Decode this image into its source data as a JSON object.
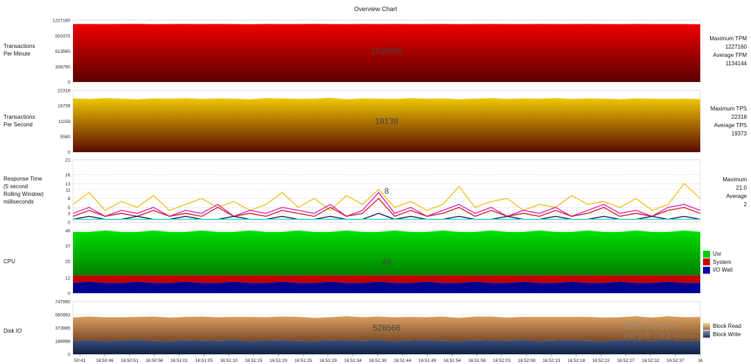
{
  "title": "Overview Chart",
  "panels": {
    "tpm": {
      "label_lines": [
        "Transactions",
        "Per Minute"
      ],
      "stats_lines": [
        "Maximum TPM",
        "1227160",
        "Average TPM",
        "1134144"
      ],
      "current_value": "1144896"
    },
    "tps": {
      "label_lines": [
        "Transactions",
        "Per Second"
      ],
      "stats_lines": [
        "Maximum TPS",
        "22318",
        "Average TPS",
        "19373"
      ],
      "current_value": "19139"
    },
    "response": {
      "label_lines": [
        "Response Time",
        "(5 second",
        "Rolling Window)",
        "milliseconds"
      ],
      "stats_lines": [
        "Maximum",
        "21.0",
        "Average",
        "2"
      ],
      "current_value": "8"
    },
    "cpu": {
      "label_lines": [
        "CPU"
      ],
      "current_value": "48",
      "legend": [
        {
          "label": "Usr",
          "color": "#00cc00"
        },
        {
          "label": "System",
          "color": "#cc0000"
        },
        {
          "label": "I/O Wait",
          "color": "#0000aa"
        }
      ]
    },
    "disk": {
      "label_lines": [
        "Disk IO"
      ],
      "current_value": "528566",
      "legend": [
        {
          "label": "Block Read",
          "color": "#d9b27a"
        },
        {
          "label": "Block Write",
          "color": "#4a6a9a"
        }
      ]
    }
  },
  "watermark": {
    "line1": "激活 Windows",
    "line2": "转到\"设置\"以激活 Windows。"
  },
  "chart_data": [
    {
      "type": "area",
      "ylabel": "Transactions Per Minute",
      "ylim": [
        0,
        1227160
      ],
      "yticks": [
        "0",
        "306790",
        "613580",
        "920370",
        "1227160"
      ],
      "series": [
        {
          "name": "TPM",
          "values": [
            1150000,
            1152000,
            1149000,
            1151000,
            1153000,
            1148000,
            1150000,
            1152000,
            1149000,
            1151000,
            1150000,
            1147000,
            1152000,
            1150000,
            1149000,
            1153000,
            1150000,
            1148000,
            1151000,
            1150000,
            1152000,
            1149000,
            1150000,
            1151000,
            1148000,
            1150000,
            1152000,
            1149000,
            1150000,
            1151000,
            1150000,
            1149000,
            1152000,
            1150000,
            1148000,
            1151000,
            1150000,
            1149000,
            1150000,
            1144896
          ]
        }
      ]
    },
    {
      "type": "area",
      "ylabel": "Transactions Per Second",
      "ylim": [
        0,
        22318
      ],
      "yticks": [
        "0",
        "5580",
        "11159",
        "16739",
        "22318"
      ],
      "series": [
        {
          "name": "TPS",
          "values": [
            19400,
            19200,
            19500,
            19300,
            19100,
            19400,
            19300,
            19500,
            19200,
            19400,
            19300,
            19100,
            19500,
            19400,
            19200,
            19300,
            19600,
            19100,
            19400,
            19300,
            19200,
            19500,
            19300,
            19400,
            19100,
            19300,
            19500,
            19200,
            19400,
            19300,
            19500,
            19200,
            19400,
            19300,
            19100,
            19400,
            19300,
            19200,
            19300,
            19139
          ]
        }
      ]
    },
    {
      "type": "line",
      "ylabel": "Response Time (5 second Rolling Window) milliseconds",
      "ylim": [
        0,
        21
      ],
      "yticks": [
        "0",
        "3",
        "5",
        "8",
        "11",
        "13",
        "16",
        "21"
      ],
      "series": [
        {
          "color": "#f0c020",
          "values": [
            6,
            10,
            4,
            7,
            5,
            9,
            4,
            6,
            8,
            5,
            7,
            4,
            6,
            10,
            5,
            8,
            4,
            9,
            6,
            11,
            5,
            7,
            4,
            6,
            12,
            5,
            7,
            8,
            4,
            6,
            5,
            9,
            6,
            7,
            5,
            8,
            4,
            6,
            13,
            8
          ]
        },
        {
          "color": "#e020c0",
          "values": [
            3,
            5,
            2,
            4,
            3,
            5,
            2,
            4,
            3,
            6,
            2,
            4,
            3,
            5,
            4,
            3,
            6,
            2,
            4,
            10,
            3,
            5,
            2,
            4,
            6,
            3,
            5,
            2,
            4,
            3,
            5,
            2,
            4,
            6,
            3,
            4,
            2,
            5,
            6,
            4
          ]
        },
        {
          "color": "#cc2020",
          "values": [
            2,
            4,
            2,
            3,
            2,
            4,
            2,
            3,
            2,
            5,
            2,
            3,
            2,
            4,
            3,
            2,
            5,
            2,
            3,
            8,
            2,
            4,
            2,
            3,
            5,
            2,
            4,
            2,
            3,
            2,
            4,
            2,
            3,
            5,
            2,
            3,
            2,
            4,
            5,
            3
          ]
        },
        {
          "color": "#101060",
          "values": [
            1,
            2,
            1,
            1,
            2,
            1,
            1,
            2,
            1,
            1,
            2,
            1,
            1,
            2,
            1,
            1,
            2,
            1,
            1,
            3,
            1,
            2,
            1,
            1,
            2,
            1,
            1,
            2,
            1,
            1,
            2,
            1,
            1,
            2,
            1,
            1,
            2,
            1,
            2,
            1
          ]
        },
        {
          "color": "#20d8c0",
          "values": [
            1,
            1,
            1,
            1,
            1,
            1,
            1,
            1,
            1,
            1,
            1,
            1,
            1,
            1,
            1,
            1,
            1,
            1,
            1,
            1,
            1,
            1,
            1,
            1,
            1,
            1,
            1,
            1,
            1,
            1,
            1,
            1,
            1,
            1,
            1,
            1,
            1,
            1,
            1,
            1
          ]
        }
      ]
    },
    {
      "type": "area",
      "ylabel": "CPU",
      "ylim": [
        0,
        49
      ],
      "yticks": [
        "0",
        "12",
        "25",
        "37",
        "49"
      ],
      "series": [
        {
          "name": "I/O Wait",
          "values": [
            8,
            9,
            8,
            8,
            9,
            8,
            8,
            9,
            8,
            8,
            9,
            8,
            8,
            9,
            8,
            8,
            9,
            8,
            8,
            9,
            8,
            8,
            9,
            8,
            8,
            9,
            8,
            8,
            9,
            8,
            8,
            9,
            8,
            8,
            9,
            8,
            8,
            9,
            8,
            8
          ]
        },
        {
          "name": "System",
          "values": [
            6,
            5,
            6,
            6,
            5,
            6,
            6,
            5,
            6,
            6,
            5,
            6,
            6,
            5,
            6,
            6,
            5,
            6,
            6,
            5,
            6,
            6,
            5,
            6,
            6,
            5,
            6,
            6,
            5,
            6,
            6,
            5,
            6,
            6,
            5,
            6,
            6,
            5,
            6,
            6
          ]
        },
        {
          "name": "Usr",
          "values": [
            34,
            34,
            35,
            34,
            34,
            35,
            34,
            34,
            35,
            34,
            34,
            35,
            34,
            34,
            35,
            34,
            34,
            35,
            34,
            34,
            35,
            34,
            34,
            35,
            34,
            34,
            35,
            34,
            34,
            35,
            34,
            34,
            35,
            34,
            34,
            35,
            34,
            34,
            35,
            34
          ]
        }
      ]
    },
    {
      "type": "area",
      "ylabel": "Disk IO",
      "ylim": [
        0,
        747990
      ],
      "yticks": [
        "0",
        "186998",
        "373995",
        "560993",
        "747990"
      ],
      "series": [
        {
          "name": "Block Write",
          "values": [
            190000,
            200000,
            185000,
            195000,
            205000,
            190000,
            185000,
            200000,
            195000,
            190000,
            205000,
            185000,
            195000,
            200000,
            190000,
            185000,
            200000,
            195000,
            190000,
            205000,
            185000,
            195000,
            200000,
            190000,
            185000,
            200000,
            195000,
            190000,
            205000,
            185000,
            195000,
            200000,
            190000,
            185000,
            200000,
            195000,
            190000,
            205000,
            185000,
            195000
          ]
        },
        {
          "name": "Block Read",
          "values": [
            330000,
            335000,
            340000,
            330000,
            325000,
            345000,
            335000,
            330000,
            340000,
            335000,
            325000,
            345000,
            330000,
            335000,
            340000,
            330000,
            325000,
            345000,
            335000,
            330000,
            340000,
            335000,
            325000,
            345000,
            330000,
            335000,
            340000,
            330000,
            325000,
            345000,
            335000,
            330000,
            340000,
            335000,
            325000,
            345000,
            330000,
            335000,
            340000,
            333566
          ]
        }
      ]
    }
  ],
  "x_tick_labels": [
    "50:41",
    "16:50:46",
    "16:50:51",
    "16:50:56",
    "16:51:01",
    "16:51:05",
    "16:51:10",
    "16:51:15",
    "16:51:20",
    "16:51:25",
    "16:51:29",
    "16:51:34",
    "16:51:39",
    "16:51:44",
    "16:51:49",
    "16:51:54",
    "16:51:58",
    "16:52:03",
    "16:52:08",
    "16:52:13",
    "16:52:18",
    "16:52:22",
    "16:52:27",
    "16:52:32",
    "16:52:37",
    "16"
  ]
}
